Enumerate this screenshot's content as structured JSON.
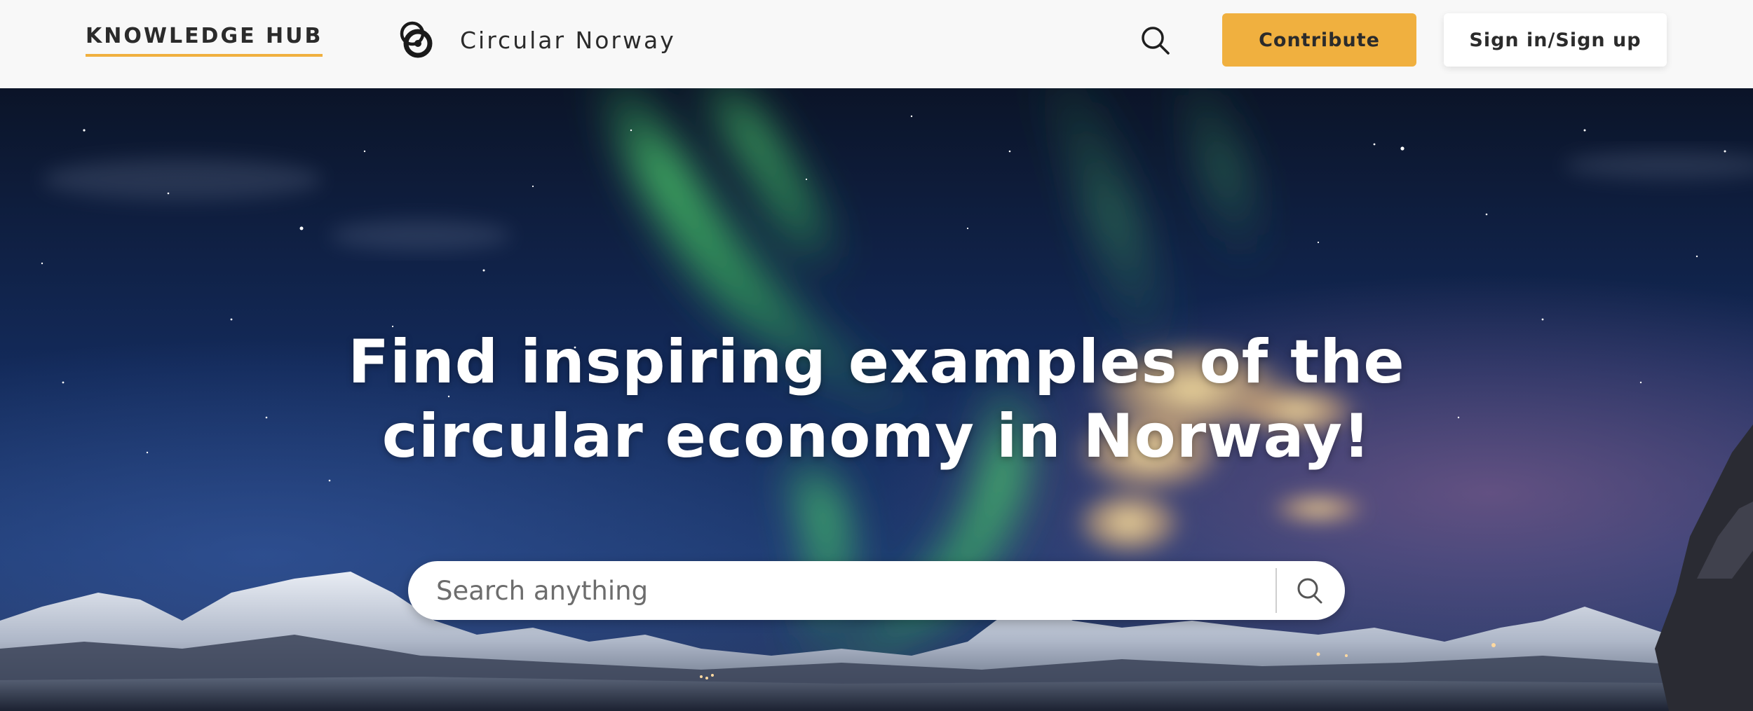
{
  "header": {
    "knowledge_hub": "KNOWLEDGE HUB",
    "brand_name": "Circular Norway",
    "contribute_label": "Contribute",
    "signin_label": "Sign in/Sign up",
    "icons": [
      "circular-norway-logo-icon",
      "search-icon"
    ]
  },
  "hero": {
    "title_line1": "Find inspiring examples of the",
    "title_line2": "circular economy in Norway!",
    "search_placeholder": "Search anything",
    "background": "northern-lights-over-snowy-mountains-image"
  },
  "colors": {
    "accent": "#f0b03f",
    "text_dark": "#2b2b2b",
    "header_bg": "#f8f8f8",
    "sky": "#0d1a3a",
    "aurora": "#4ed26e"
  }
}
